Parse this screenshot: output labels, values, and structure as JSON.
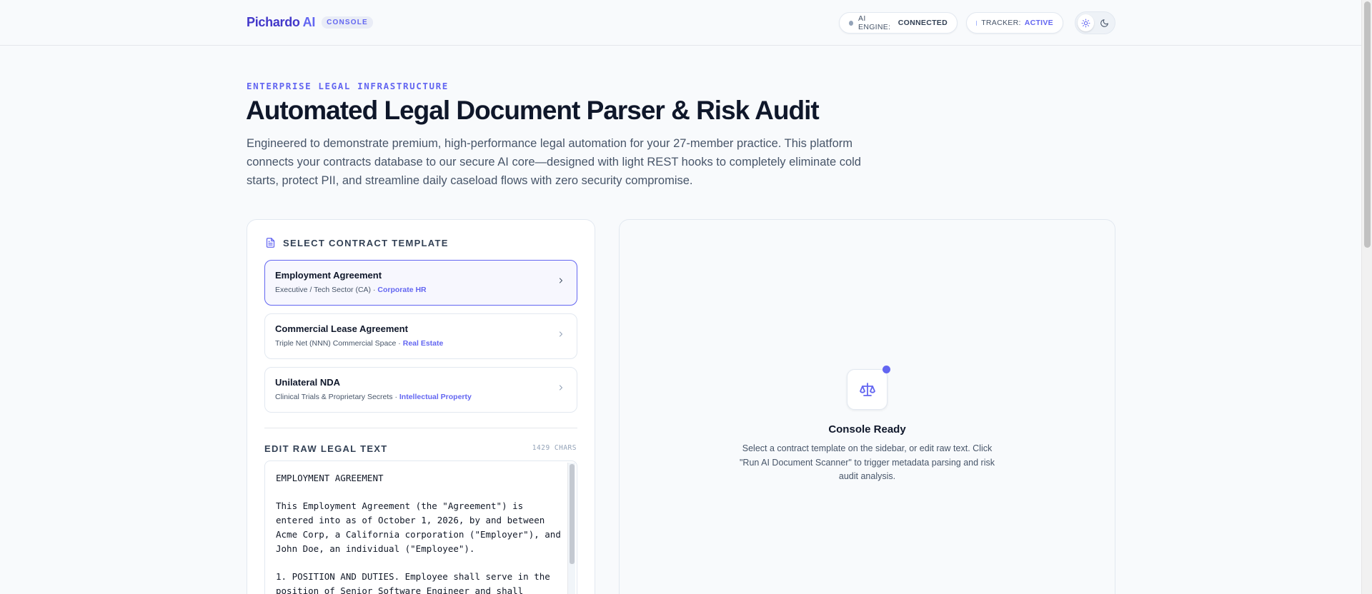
{
  "header": {
    "brand_prefix": "Pichardo",
    "brand_suffix": "AI",
    "brand_badge": "CONSOLE",
    "ai_engine_label": "AI ENGINE:",
    "ai_engine_value": "CONNECTED",
    "tracker_label": "TRACKER:",
    "tracker_value": "ACTIVE",
    "theme_options": [
      "sun-icon",
      "moon-icon"
    ],
    "theme_selected": "light"
  },
  "hero": {
    "eyebrow": "ENTERPRISE LEGAL INFRASTRUCTURE",
    "title": "Automated Legal Document Parser & Risk Audit",
    "description": "Engineered to demonstrate premium, high-performance legal automation for your 27-member practice. This platform connects your contracts database to our secure AI core—designed with light REST hooks to completely eliminate cold starts, protect PII, and streamline daily caseload flows with zero security compromise."
  },
  "templates": {
    "heading": "SELECT CONTRACT TEMPLATE",
    "items": [
      {
        "title": "Employment Agreement",
        "subtitle": "Executive / Tech Sector (CA) · ",
        "category": "Corporate HR",
        "selected": true
      },
      {
        "title": "Commercial Lease Agreement",
        "subtitle": "Triple Net (NNN) Commercial Space · ",
        "category": "Real Estate",
        "selected": false
      },
      {
        "title": "Unilateral NDA",
        "subtitle": "Clinical Trials & Proprietary Secrets · ",
        "category": "Intellectual Property",
        "selected": false
      }
    ]
  },
  "editor": {
    "heading": "EDIT RAW LEGAL TEXT",
    "char_count": "1429 CHARS",
    "text": "EMPLOYMENT AGREEMENT\n\nThis Employment Agreement (the \"Agreement\") is entered into as of October 1, 2026, by and between Acme Corp, a California corporation (\"Employer\"), and John Doe, an individual (\"Employee\").\n\n1. POSITION AND DUTIES. Employee shall serve in the position of Senior Software Engineer and shall"
  },
  "console": {
    "title": "Console Ready",
    "description": "Select a contract template on the sidebar, or edit raw text. Click \"Run AI Document Scanner\" to trigger metadata parsing and risk audit analysis."
  },
  "colors": {
    "accent": "#6366f1",
    "brand": "#4338ca",
    "text": "#0f172a",
    "muted": "#475569",
    "background": "#f8fafc"
  }
}
